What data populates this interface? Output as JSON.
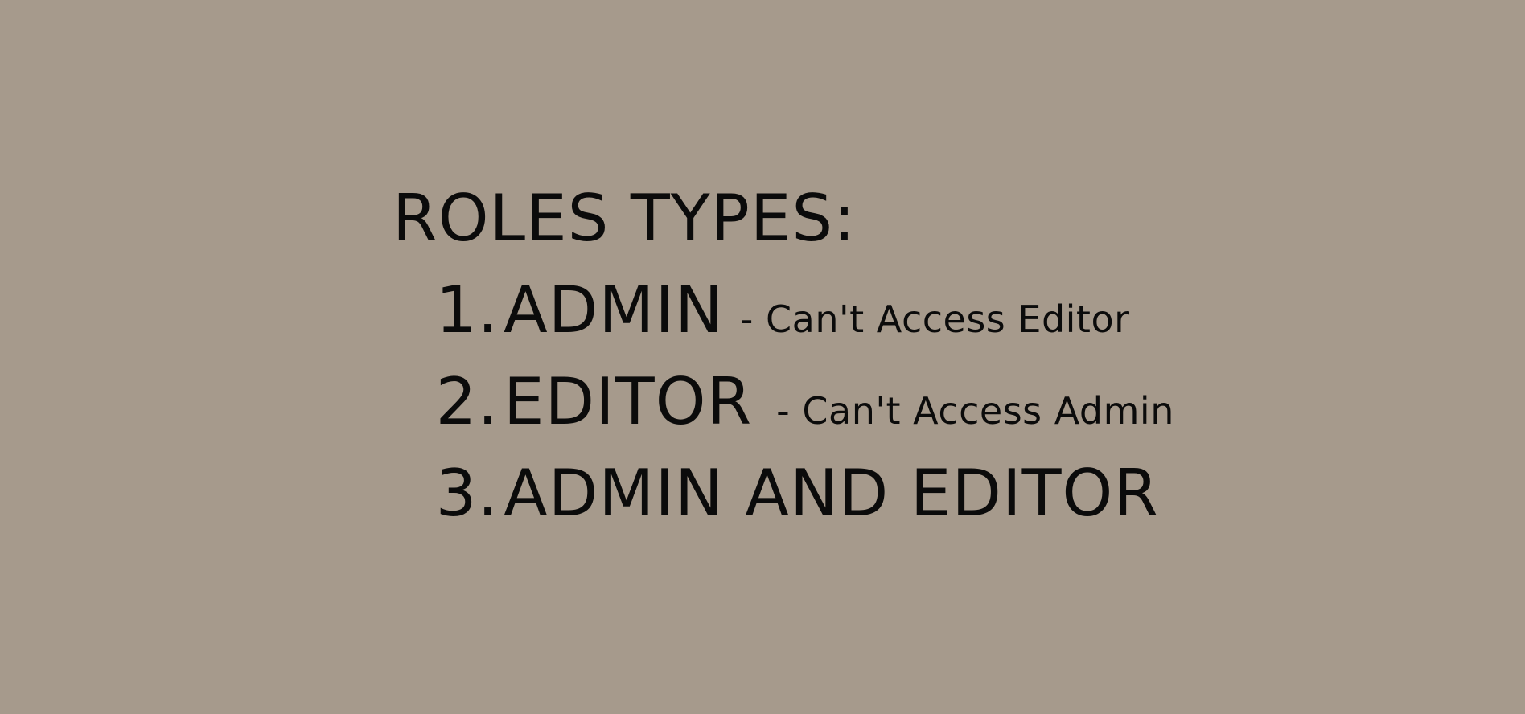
{
  "slide": {
    "heading": "ROLES TYPES:",
    "roles": [
      {
        "number": "1.",
        "name": "ADMIN",
        "note": "- Can't Access Editor"
      },
      {
        "number": "2.",
        "name": "EDITOR",
        "note": "- Can't Access Admin"
      },
      {
        "number": "3.",
        "name": "ADMIN AND EDITOR",
        "note": ""
      }
    ]
  },
  "colors": {
    "background": "#a69a8c",
    "text": "#0b0b0b"
  }
}
